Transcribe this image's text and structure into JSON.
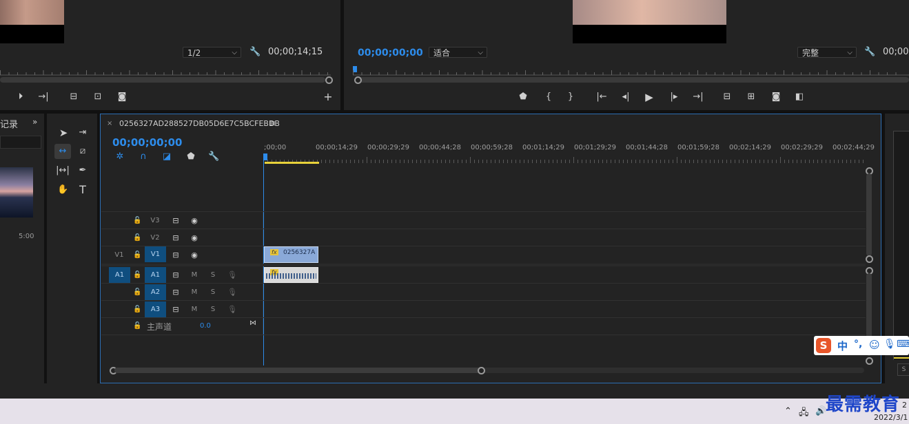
{
  "source_monitor": {
    "resolution_value": "1/2",
    "timecode": "00;00;14;15"
  },
  "program_monitor": {
    "timecode": "00;00;00;00",
    "fit_value": "适合",
    "quality_value": "完整",
    "timecode_right": "00;00"
  },
  "project_panel": {
    "tab_label": "记录",
    "duration": "5:00"
  },
  "timeline": {
    "tab_title": "0256327AD288527DB05D6E7C5BCFEBDB",
    "timecode": "00;00;00;00",
    "ruler_labels": [
      ";00;00",
      "00;00;14;29",
      "00;00;29;29",
      "00;00;44;28",
      "00;00;59;28",
      "00;01;14;29",
      "00;01;29;29",
      "00;01;44;28",
      "00;01;59;28",
      "00;02;14;29",
      "00;02;29;29",
      "00;02;44;29"
    ],
    "tracks": {
      "v3": "V3",
      "v2": "V2",
      "v1_source": "V1",
      "v1": "V1",
      "a1_source": "A1",
      "a1": "A1",
      "a2": "A2",
      "a3": "A3",
      "mute": "M",
      "solo": "S",
      "master_label": "主声道",
      "master_value": "0.0"
    },
    "video_clip_label": "0256327A",
    "fx_label": "fx"
  },
  "ime_toolbar": {
    "logo": "S",
    "lang": "中",
    "punct": "°,"
  },
  "taskbar": {
    "time_fragment": "2",
    "date_fragment": "2022/3/1"
  },
  "watermark": {
    "text": "最需教育"
  },
  "colors": {
    "accent_blue": "#2d8ceb",
    "track_blue": "#0f4e7f",
    "clip_video": "#8aa9d8",
    "work_area_yellow": "#e8d23a"
  }
}
